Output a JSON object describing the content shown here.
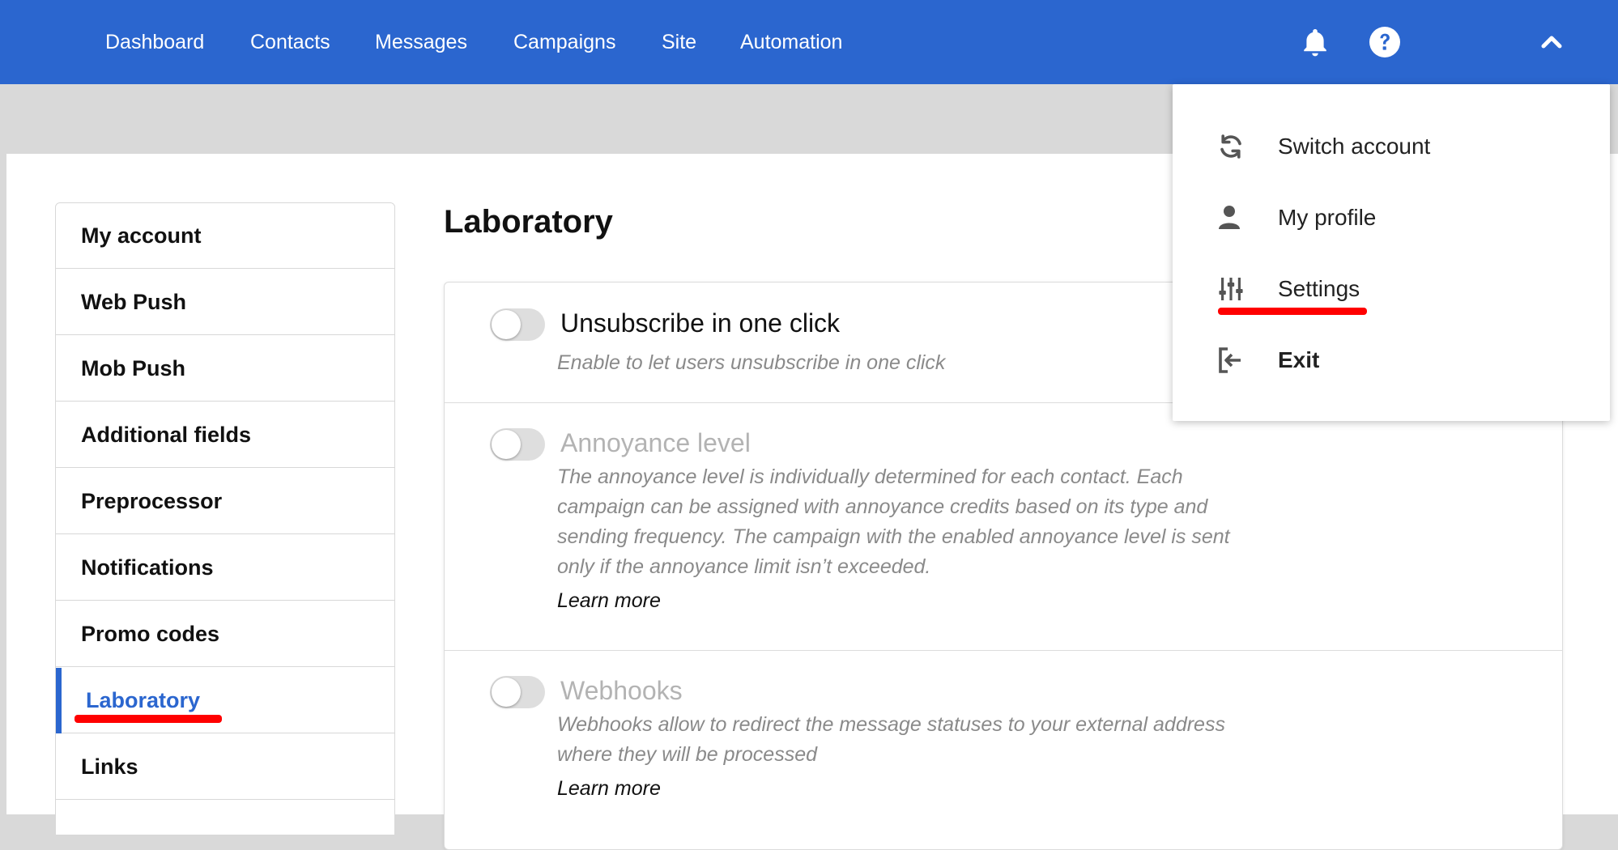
{
  "nav": {
    "items": [
      {
        "label": "Dashboard"
      },
      {
        "label": "Contacts"
      },
      {
        "label": "Messages"
      },
      {
        "label": "Campaigns"
      },
      {
        "label": "Site"
      },
      {
        "label": "Automation"
      }
    ],
    "icons": [
      "bell-icon",
      "help-icon",
      "chevron-up-icon"
    ],
    "bar_color": "#2b66cf"
  },
  "sidebar": {
    "items": [
      {
        "label": "My account"
      },
      {
        "label": "Web Push"
      },
      {
        "label": "Mob Push"
      },
      {
        "label": "Additional fields"
      },
      {
        "label": "Preprocessor"
      },
      {
        "label": "Notifications"
      },
      {
        "label": "Promo codes"
      },
      {
        "label": "Laboratory",
        "active": true
      },
      {
        "label": "Links"
      }
    ]
  },
  "main": {
    "title": "Laboratory",
    "features": [
      {
        "title": "Unsubscribe in one click",
        "description": "Enable to let users unsubscribe in one click",
        "enabled": false,
        "disabled_look": false
      },
      {
        "title": "Annoyance level",
        "description": "The annoyance level is individually determined for each contact. Each campaign can be assigned with annoyance credits based on its type and sending frequency. The campaign with the enabled annoyance level is sent only if the annoyance limit isn’t exceeded.",
        "learn_more": "Learn more",
        "enabled": false,
        "disabled_look": true
      },
      {
        "title": "Webhooks",
        "description": "Webhooks allow to redirect the message statuses to your external address where they will be processed",
        "learn_more": "Learn more",
        "enabled": false,
        "disabled_look": true
      }
    ]
  },
  "account_menu": {
    "items": [
      {
        "label": "Switch account",
        "icon": "refresh-icon"
      },
      {
        "label": "My profile",
        "icon": "user-icon"
      },
      {
        "label": "Settings",
        "icon": "sliders-icon"
      },
      {
        "label": "Exit",
        "icon": "exit-icon"
      }
    ]
  },
  "colors": {
    "accent": "#2b66cf",
    "annotation": "#ff0000"
  }
}
